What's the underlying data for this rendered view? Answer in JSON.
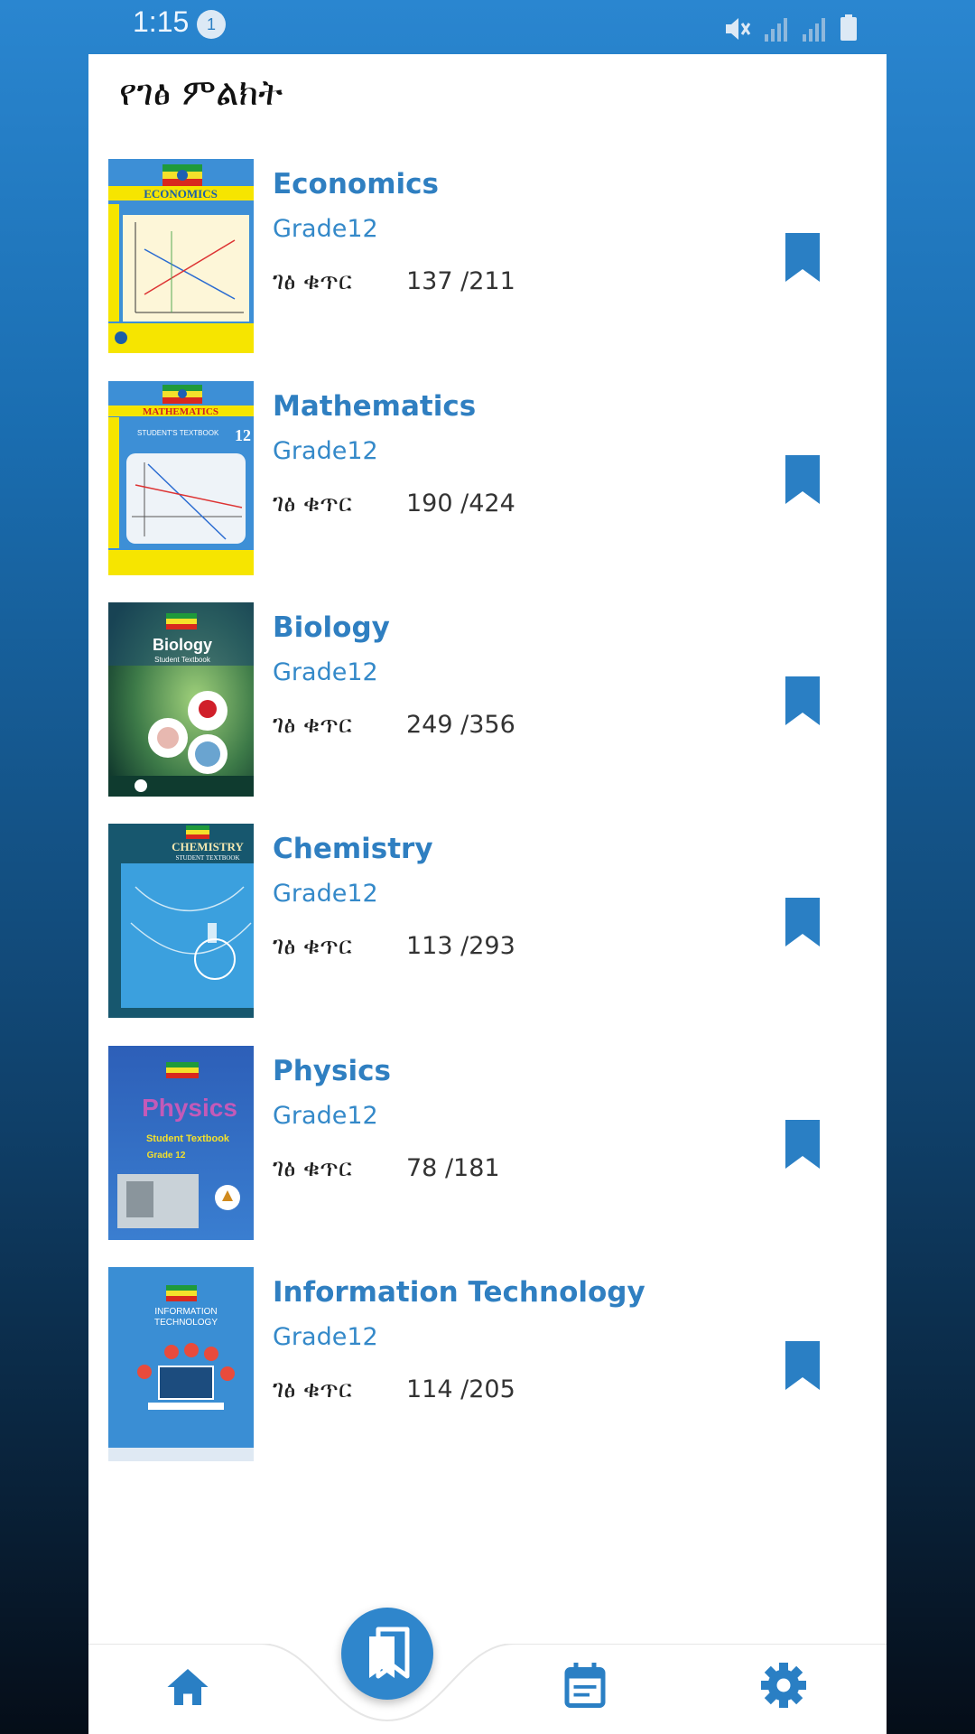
{
  "status_bar": {
    "time": "1:15",
    "notification_count": "1",
    "icons": [
      "mute-icon",
      "signal-icon",
      "signal-icon",
      "battery-icon"
    ]
  },
  "page": {
    "title": "የገፅ ምልክት"
  },
  "books": [
    {
      "title": "Economics",
      "grade": "Grade12",
      "page_label": "ገፅ ቁጥር",
      "pages": "137 /211",
      "cover": "economics-cover"
    },
    {
      "title": "Mathematics",
      "grade": "Grade12",
      "page_label": "ገፅ ቁጥር",
      "pages": "190 /424",
      "cover": "mathematics-cover"
    },
    {
      "title": "Biology",
      "grade": "Grade12",
      "page_label": "ገፅ ቁጥር",
      "pages": "249 /356",
      "cover": "biology-cover"
    },
    {
      "title": "Chemistry",
      "grade": "Grade12",
      "page_label": "ገፅ ቁጥር",
      "pages": "113 /293",
      "cover": "chemistry-cover"
    },
    {
      "title": "Physics",
      "grade": "Grade12",
      "page_label": "ገፅ ቁጥር",
      "pages": "78 /181",
      "cover": "physics-cover"
    },
    {
      "title": "Information Technology",
      "grade": "Grade12",
      "page_label": "ገፅ ቁጥር",
      "pages": "114 /205",
      "cover": "information-technology-cover"
    }
  ],
  "bottom_nav": {
    "items": [
      "home-icon",
      "bookmarks-icon",
      "calendar-icon",
      "settings-icon"
    ],
    "active": "bookmarks-icon"
  },
  "colors": {
    "accent": "#2f7fc1",
    "bookmark": "#2a7fc4",
    "panel": "#ffffff"
  }
}
